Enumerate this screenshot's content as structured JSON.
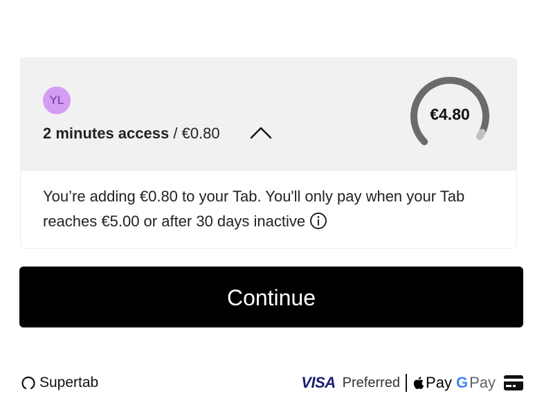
{
  "offer": {
    "avatar_initials": "YL",
    "access_label": "2 minutes access",
    "price_sep": " / ",
    "price": "€0.80",
    "tab_total": "€4.80",
    "tab_progress_fraction": 0.96
  },
  "info": {
    "text": "You’re adding €0.80 to your Tab. You'll only pay when your Tab reaches €5.00 or after 30 days inactive"
  },
  "actions": {
    "continue_label": "Continue"
  },
  "footer": {
    "brand": "Supertab",
    "visa_label": "VISA",
    "preferred_label": "Preferred",
    "apple_pay_label": "Pay",
    "google_pay_g": "G",
    "google_pay_label": "Pay"
  },
  "colors": {
    "avatar_bg": "#d49cf2",
    "gauge_track": "#6b6b6b",
    "gauge_end": "#c0c0c0",
    "button_bg": "#000000",
    "visa_blue": "#1a1f71"
  }
}
